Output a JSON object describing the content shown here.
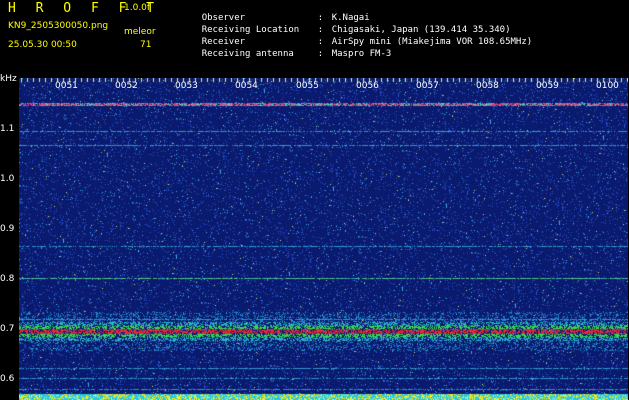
{
  "header": {
    "brand": "H R O F F T",
    "version": "1.0.0f",
    "filename": "KN9_2505300050.png",
    "datetime": "25.05.30 00:50",
    "counter_label": "meleor",
    "counter_value": "71"
  },
  "info": [
    {
      "key": "Observer",
      "value": "K.Nagai"
    },
    {
      "key": "Receiving Location",
      "value": "Chigasaki, Japan (139.414 35.340)"
    },
    {
      "key": "Receiver",
      "value": "AirSpy mini (Miakejima VOR 108.65MHz)"
    },
    {
      "key": "Receiving antenna",
      "value": "Maspro FM-3"
    }
  ],
  "axis": {
    "y_unit": "kHz",
    "y_ticks": [
      "1.1",
      "1.0",
      "0.9",
      "0.8",
      "0.7",
      "0.6"
    ],
    "x_ticks": [
      "0051",
      "0052",
      "0053",
      "0054",
      "0055",
      "0056",
      "0057",
      "0058",
      "0059",
      "0100"
    ]
  },
  "colors": {
    "background": "#000000",
    "brand": "#ffff00",
    "text": "#ffffff",
    "noise_base": "#0a1a6e"
  }
}
